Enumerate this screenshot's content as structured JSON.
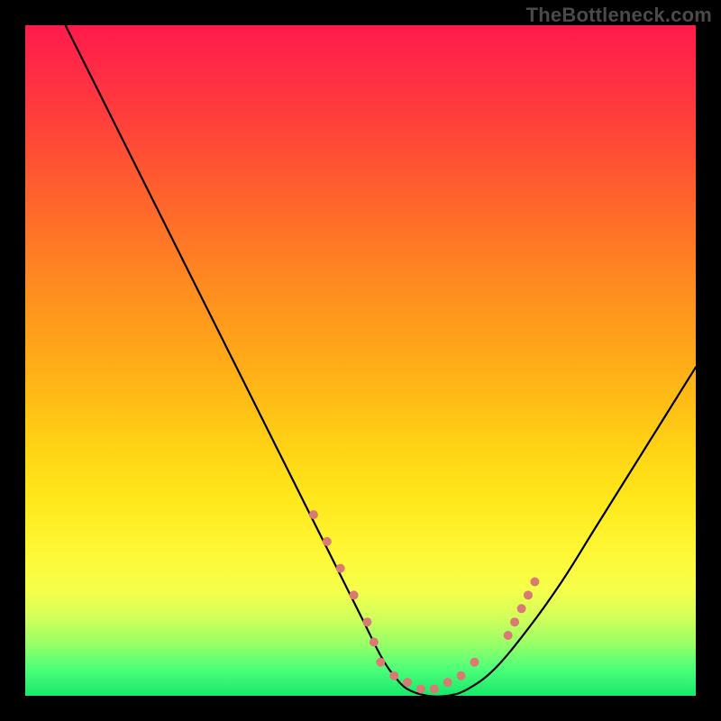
{
  "watermark": "TheBottleneck.com",
  "chart_data": {
    "type": "line",
    "title": "",
    "xlabel": "",
    "ylabel": "",
    "xlim": [
      0,
      100
    ],
    "ylim": [
      0,
      100
    ],
    "grid": false,
    "legend": false,
    "notes": "Smooth V-shaped curve plotted over a vertical red-to-green gradient. No numeric axis ticks or labels are visible.",
    "series": [
      {
        "name": "bottleneck-curve",
        "color": "#000000",
        "x": [
          6,
          10,
          15,
          20,
          25,
          30,
          35,
          40,
          45,
          50,
          53,
          55,
          57,
          60,
          63,
          66,
          70,
          75,
          80,
          85,
          90,
          95,
          100
        ],
        "values": [
          100,
          92,
          82,
          72,
          62,
          52,
          42,
          32,
          22,
          12,
          6,
          3,
          1,
          0,
          0,
          1,
          4,
          10,
          17,
          25,
          33,
          41,
          49
        ]
      }
    ],
    "markers": [
      {
        "name": "dense-dots-near-minimum",
        "color": "#d87b73",
        "radius_approx_px": 5,
        "x": [
          43,
          45,
          47,
          49,
          51,
          52,
          53,
          55,
          57,
          59,
          61,
          63,
          65,
          67,
          72,
          73,
          74,
          75,
          76
        ],
        "values": [
          27,
          23,
          19,
          15,
          11,
          8,
          5,
          3,
          2,
          1,
          1,
          2,
          3,
          5,
          9,
          11,
          13,
          15,
          17
        ]
      }
    ]
  }
}
